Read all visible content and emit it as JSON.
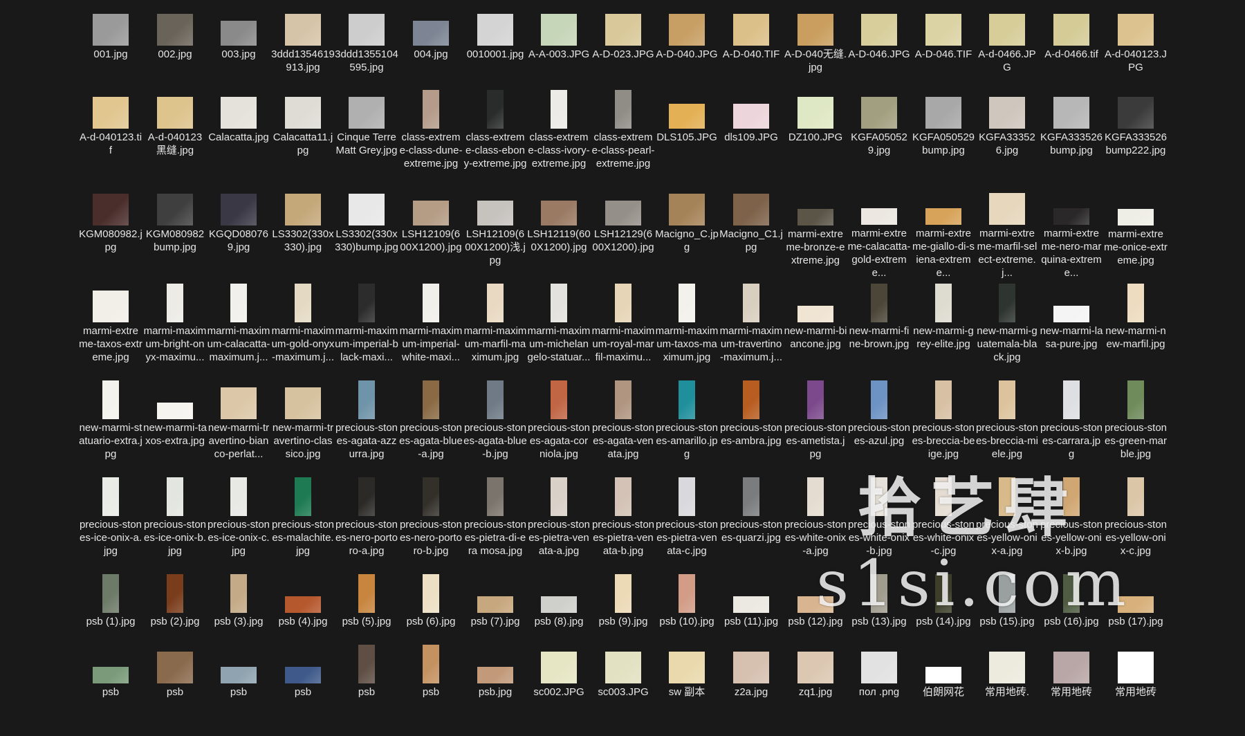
{
  "files": [
    {
      "name": "001.jpg",
      "thumb": "tall",
      "color": "#9a9a9a"
    },
    {
      "name": "002.jpg",
      "thumb": "tall",
      "color": "#6a6359"
    },
    {
      "name": "003.jpg",
      "thumb": "wide",
      "color": "#8a8a8a"
    },
    {
      "name": "3ddd1354619913.jpg",
      "thumb": "tall",
      "color": "#d6c4a8"
    },
    {
      "name": "3ddd1355104595.jpg",
      "thumb": "tall",
      "color": "#cdcdcd"
    },
    {
      "name": "004.jpg",
      "thumb": "wide",
      "color": "#7d8594"
    },
    {
      "name": "0010001.jpg",
      "thumb": "tall",
      "color": "#d4d4d4"
    },
    {
      "name": "A-A-003.JPG",
      "thumb": "tall",
      "color": "#c6d6b8"
    },
    {
      "name": "A-D-023.JPG",
      "thumb": "tall",
      "color": "#d9c99a"
    },
    {
      "name": "A-D-040.JPG",
      "thumb": "tall",
      "color": "#c79f64"
    },
    {
      "name": "A-D-040.TIF",
      "thumb": "tall",
      "color": "#dcc089"
    },
    {
      "name": "A-D-040无缝.jpg",
      "thumb": "tall",
      "color": "#c99e5e"
    },
    {
      "name": "A-D-046.JPG",
      "thumb": "tall",
      "color": "#d8ce9c"
    },
    {
      "name": "A-D-046.TIF",
      "thumb": "tall",
      "color": "#dcd3a4"
    },
    {
      "name": "A-d-0466.JPG",
      "thumb": "tall",
      "color": "#d6cd99"
    },
    {
      "name": "A-d-0466.tif",
      "thumb": "tall",
      "color": "#d4cb97"
    },
    {
      "name": "A-d-040123.JPG",
      "thumb": "tall",
      "color": "#dcc28e"
    },
    {
      "name": "A-d-040123.tif",
      "thumb": "tall",
      "color": "#e1c690"
    },
    {
      "name": "A-d-040123黑缝.jpg",
      "thumb": "tall",
      "color": "#ddc38c"
    },
    {
      "name": "Calacatta.jpg",
      "thumb": "tall",
      "color": "#e4e2da"
    },
    {
      "name": "Calacatta11.jpg",
      "thumb": "tall",
      "color": "#dedcd5"
    },
    {
      "name": "Cinque Terre Matt Grey.jpg",
      "thumb": "tall",
      "color": "#b0b0b0"
    },
    {
      "name": "class-extreme-class-dune-extreme.jpg",
      "thumb": "narrow",
      "color": "#b59c8a"
    },
    {
      "name": "class-extreme-class-ebony-extreme.jpg",
      "thumb": "narrow",
      "color": "#2a2c2c"
    },
    {
      "name": "class-extreme-class-ivory-extreme.jpg",
      "thumb": "narrow",
      "color": "#ecebe7"
    },
    {
      "name": "class-extreme-class-pearl-extreme.jpg",
      "thumb": "narrow",
      "color": "#908d87"
    },
    {
      "name": "DLS105.JPG",
      "thumb": "wide",
      "color": "#e3b055"
    },
    {
      "name": "dls109.JPG",
      "thumb": "wide",
      "color": "#ecd6dc"
    },
    {
      "name": "DZ100.JPG",
      "thumb": "tall",
      "color": "#dfe8c4"
    },
    {
      "name": "KGFA050529.jpg",
      "thumb": "tall",
      "color": "#a29f80"
    },
    {
      "name": "KGFA050529bump.jpg",
      "thumb": "tall",
      "color": "#a8a8a8"
    },
    {
      "name": "KGFA333526.jpg",
      "thumb": "tall",
      "color": "#cfc6bd"
    },
    {
      "name": "KGFA333526bump.jpg",
      "thumb": "tall",
      "color": "#b7b7b7"
    },
    {
      "name": "KGFA333526bump222.jpg",
      "thumb": "tall",
      "color": "#3b3b3b"
    },
    {
      "name": "KGM080982.jpg",
      "thumb": "tall",
      "color": "#4a2e2c"
    },
    {
      "name": "KGM080982bump.jpg",
      "thumb": "tall",
      "color": "#3f3f3f"
    },
    {
      "name": "KGQD080769.jpg",
      "thumb": "tall",
      "color": "#3a3845"
    },
    {
      "name": "LS3302(330x330).jpg",
      "thumb": "tall",
      "color": "#c4a87a"
    },
    {
      "name": "LS3302(330x330)bump.jpg",
      "thumb": "tall",
      "color": "#e8e8e8"
    },
    {
      "name": "LSH12109(600X1200).jpg",
      "thumb": "wide",
      "color": "#b49c85"
    },
    {
      "name": "LSH12109(600X1200)浅.jpg",
      "thumb": "wide",
      "color": "#c6c3bf"
    },
    {
      "name": "LSH12119(600X1200).jpg",
      "thumb": "wide",
      "color": "#9a7a63"
    },
    {
      "name": "LSH12129(600X1200).jpg",
      "thumb": "wide",
      "color": "#958f89"
    },
    {
      "name": "Macigno_C.jpg",
      "thumb": "tall",
      "color": "#a58358"
    },
    {
      "name": "Macigno_C1.jpg",
      "thumb": "tall",
      "color": "#7e624a"
    },
    {
      "name": "marmi-extreme-bronze-extreme.jpg",
      "thumb": "flat",
      "color": "#5b5548"
    },
    {
      "name": "marmi-extreme-calacatta-gold-extreme...",
      "thumb": "flat",
      "color": "#ece8e1"
    },
    {
      "name": "marmi-extreme-giallo-di-siena-extreme...",
      "thumb": "flat",
      "color": "#d7a35a"
    },
    {
      "name": "marmi-extreme-marfil-select-extreme.j...",
      "thumb": "tall",
      "color": "#e6d7bd"
    },
    {
      "name": "marmi-extreme-nero-marquina-extreme...",
      "thumb": "flat",
      "color": "#2a2829"
    },
    {
      "name": "marmi-extreme-onice-extreme.jpg",
      "thumb": "flat",
      "color": "#efeee6"
    },
    {
      "name": "marmi-extreme-taxos-extreme.jpg",
      "thumb": "tall",
      "color": "#f2eee8"
    },
    {
      "name": "marmi-maximum-bright-onyx-maximu...",
      "thumb": "narrow",
      "color": "#ecebe6"
    },
    {
      "name": "marmi-maximum-calacatta-maximum.j...",
      "thumb": "narrow",
      "color": "#f1f0ec"
    },
    {
      "name": "marmi-maximum-gold-onyx-maximum.j...",
      "thumb": "narrow",
      "color": "#e4dac4"
    },
    {
      "name": "marmi-maximum-imperial-black-maxi...",
      "thumb": "narrow",
      "color": "#2c2c2c"
    },
    {
      "name": "marmi-maximum-imperial-white-maxi...",
      "thumb": "narrow",
      "color": "#f0efea"
    },
    {
      "name": "marmi-maximum-marfil-maximum.jpg",
      "thumb": "narrow",
      "color": "#e9d9c2"
    },
    {
      "name": "marmi-maximum-michelangelo-statuar...",
      "thumb": "narrow",
      "color": "#e3e2de"
    },
    {
      "name": "marmi-maximum-royal-marfil-maximu...",
      "thumb": "narrow",
      "color": "#e6d5b6"
    },
    {
      "name": "marmi-maximum-taxos-maximum.jpg",
      "thumb": "narrow",
      "color": "#f3f1ec"
    },
    {
      "name": "marmi-maximum-travertino-maximum.j...",
      "thumb": "narrow",
      "color": "#d9cfc0"
    },
    {
      "name": "new-marmi-biancone.jpg",
      "thumb": "flat",
      "color": "#f0e4d3"
    },
    {
      "name": "new-marmi-fine-brown.jpg",
      "thumb": "narrow",
      "color": "#4b4637"
    },
    {
      "name": "new-marmi-grey-elite.jpg",
      "thumb": "narrow",
      "color": "#dedbd0"
    },
    {
      "name": "new-marmi-guatemala-black.jpg",
      "thumb": "narrow",
      "color": "#2e3430"
    },
    {
      "name": "new-marmi-lasa-pure.jpg",
      "thumb": "flat",
      "color": "#f4f4f4"
    },
    {
      "name": "new-marmi-new-marfil.jpg",
      "thumb": "narrow",
      "color": "#eddcc0"
    },
    {
      "name": "new-marmi-statuario-extra.jpg",
      "thumb": "narrow",
      "color": "#f4f2ec"
    },
    {
      "name": "new-marmi-taxos-extra.jpg",
      "thumb": "flat",
      "color": "#f6f4ef"
    },
    {
      "name": "new-marmi-travertino-bianco-perlat...",
      "thumb": "tall",
      "color": "#dcc8a8"
    },
    {
      "name": "new-marmi-travertino-classico.jpg",
      "thumb": "tall",
      "color": "#d6c29e"
    },
    {
      "name": "precious-stones-agata-azzurra.jpg",
      "thumb": "narrow",
      "color": "#6f93a8"
    },
    {
      "name": "precious-stones-agata-blue-a.jpg",
      "thumb": "narrow",
      "color": "#8a6a44"
    },
    {
      "name": "precious-stones-agata-blue-b.jpg",
      "thumb": "narrow",
      "color": "#6f7a86"
    },
    {
      "name": "precious-stones-agata-corniola.jpg",
      "thumb": "narrow",
      "color": "#c06645"
    },
    {
      "name": "precious-stones-agata-venata.jpg",
      "thumb": "narrow",
      "color": "#b09580"
    },
    {
      "name": "precious-stones-amarillo.jpg",
      "thumb": "narrow",
      "color": "#1f8f9c"
    },
    {
      "name": "precious-stones-ambra.jpg",
      "thumb": "narrow",
      "color": "#b85d21"
    },
    {
      "name": "precious-stones-ametista.jpg",
      "thumb": "narrow",
      "color": "#7c4a8c"
    },
    {
      "name": "precious-stones-azul.jpg",
      "thumb": "narrow",
      "color": "#6d92c4"
    },
    {
      "name": "precious-stones-breccia-beige.jpg",
      "thumb": "narrow",
      "color": "#d7c0a4"
    },
    {
      "name": "precious-stones-breccia-miele.jpg",
      "thumb": "narrow",
      "color": "#dcc39d"
    },
    {
      "name": "precious-stones-carrara.jpg",
      "thumb": "narrow",
      "color": "#dedfe2"
    },
    {
      "name": "precious-stones-green-marble.jpg",
      "thumb": "narrow",
      "color": "#6f8a5b"
    },
    {
      "name": "precious-stones-ice-onix-a.jpg",
      "thumb": "narrow",
      "color": "#e9ebe7"
    },
    {
      "name": "precious-stones-ice-onix-b.jpg",
      "thumb": "narrow",
      "color": "#e3e5e0"
    },
    {
      "name": "precious-stones-ice-onix-c.jpg",
      "thumb": "narrow",
      "color": "#e8e9e5"
    },
    {
      "name": "precious-stones-malachite.jpg",
      "thumb": "narrow",
      "color": "#1d7a52"
    },
    {
      "name": "precious-stones-nero-portoro-a.jpg",
      "thumb": "narrow",
      "color": "#2b2a27"
    },
    {
      "name": "precious-stones-nero-portoro-b.jpg",
      "thumb": "narrow",
      "color": "#33302a"
    },
    {
      "name": "precious-stones-pietra-di-era mosa.jpg",
      "thumb": "narrow",
      "color": "#7b746c"
    },
    {
      "name": "precious-stones-pietra-venata-a.jpg",
      "thumb": "narrow",
      "color": "#d9d1c8"
    },
    {
      "name": "precious-stones-pietra-venata-b.jpg",
      "thumb": "narrow",
      "color": "#d3c2b5"
    },
    {
      "name": "precious-stones-pietra-venata-c.jpg",
      "thumb": "narrow",
      "color": "#d9d8dc"
    },
    {
      "name": "precious-stones-quarzi.jpg",
      "thumb": "narrow",
      "color": "#7a7c7e"
    },
    {
      "name": "precious-stones-white-onix-a.jpg",
      "thumb": "narrow",
      "color": "#e4dcd0"
    },
    {
      "name": "precious-stones-white-onix-b.jpg",
      "thumb": "narrow",
      "color": "#e6e1d8"
    },
    {
      "name": "precious-stones-white-onix-c.jpg",
      "thumb": "narrow",
      "color": "#e5ddd3"
    },
    {
      "name": "precious-stones-yellow-onix-a.jpg",
      "thumb": "narrow",
      "color": "#d7b98a"
    },
    {
      "name": "precious-stones-yellow-onix-b.jpg",
      "thumb": "narrow",
      "color": "#d0a773"
    },
    {
      "name": "precious-stones-yellow-onix-c.jpg",
      "thumb": "narrow",
      "color": "#dbc6a8"
    },
    {
      "name": "psb (1).jpg",
      "thumb": "narrow",
      "color": "#6e7a68"
    },
    {
      "name": "psb (2).jpg",
      "thumb": "narrow",
      "color": "#7a3d1c"
    },
    {
      "name": "psb (3).jpg",
      "thumb": "narrow",
      "color": "#c4aa86"
    },
    {
      "name": "psb (4).jpg",
      "thumb": "flat",
      "color": "#b6582e"
    },
    {
      "name": "psb (5).jpg",
      "thumb": "narrow",
      "color": "#c7853e"
    },
    {
      "name": "psb (6).jpg",
      "thumb": "narrow",
      "color": "#ecdfc4"
    },
    {
      "name": "psb (7).jpg",
      "thumb": "flat",
      "color": "#c7a77d"
    },
    {
      "name": "psb (8).jpg",
      "thumb": "flat",
      "color": "#cfcfcb"
    },
    {
      "name": "psb (9).jpg",
      "thumb": "narrow",
      "color": "#ecd9b6"
    },
    {
      "name": "psb (10).jpg",
      "thumb": "narrow",
      "color": "#d29c86"
    },
    {
      "name": "psb (11).jpg",
      "thumb": "flat",
      "color": "#ece9e2"
    },
    {
      "name": "psb (12).jpg",
      "thumb": "flat",
      "color": "#d8b590"
    },
    {
      "name": "psb (13).jpg",
      "thumb": "narrow",
      "color": "#a09c8e"
    },
    {
      "name": "psb (14).jpg",
      "thumb": "narrow",
      "color": "#3d3f2a"
    },
    {
      "name": "psb (15).jpg",
      "thumb": "narrow",
      "color": "#9aa0a0"
    },
    {
      "name": "psb (16).jpg",
      "thumb": "narrow",
      "color": "#4f5c42"
    },
    {
      "name": "psb (17).jpg",
      "thumb": "flat",
      "color": "#d7b07b"
    },
    {
      "name": "psb",
      "thumb": "flat",
      "color": "#7a9a7a"
    },
    {
      "name": "psb",
      "thumb": "tall",
      "color": "#8a6a4d"
    },
    {
      "name": "psb",
      "thumb": "flat",
      "color": "#8fa4b0"
    },
    {
      "name": "psb",
      "thumb": "flat",
      "color": "#3f5a8a"
    },
    {
      "name": "psb",
      "thumb": "narrow",
      "color": "#5e4e44"
    },
    {
      "name": "psb",
      "thumb": "narrow",
      "color": "#c49261"
    },
    {
      "name": "psb.jpg",
      "thumb": "flat",
      "color": "#c29a7a"
    },
    {
      "name": "sc002.JPG",
      "thumb": "tall",
      "color": "#e6e6c4"
    },
    {
      "name": "sc003.JPG",
      "thumb": "tall",
      "color": "#e2e1c2"
    },
    {
      "name": "sw 副本",
      "thumb": "tall",
      "color": "#ead9ac"
    },
    {
      "name": "z2a.jpg",
      "thumb": "tall",
      "color": "#d6c0b0"
    },
    {
      "name": "zq1.jpg",
      "thumb": "tall",
      "color": "#dcc8b2"
    },
    {
      "name": "пол .png",
      "thumb": "tall",
      "color": "#e2e2e2"
    },
    {
      "name": "伯朗网花",
      "thumb": "flat",
      "color": "#ffffff"
    },
    {
      "name": "常用地砖.",
      "thumb": "tall",
      "color": "#ecebde"
    },
    {
      "name": "常用地砖",
      "thumb": "tall",
      "color": "#b9a6a6"
    },
    {
      "name": "常用地砖",
      "thumb": "tall",
      "color": "#ffffff"
    }
  ],
  "watermark": {
    "line1": "拾艺肆",
    "line2": "s1si.com"
  }
}
